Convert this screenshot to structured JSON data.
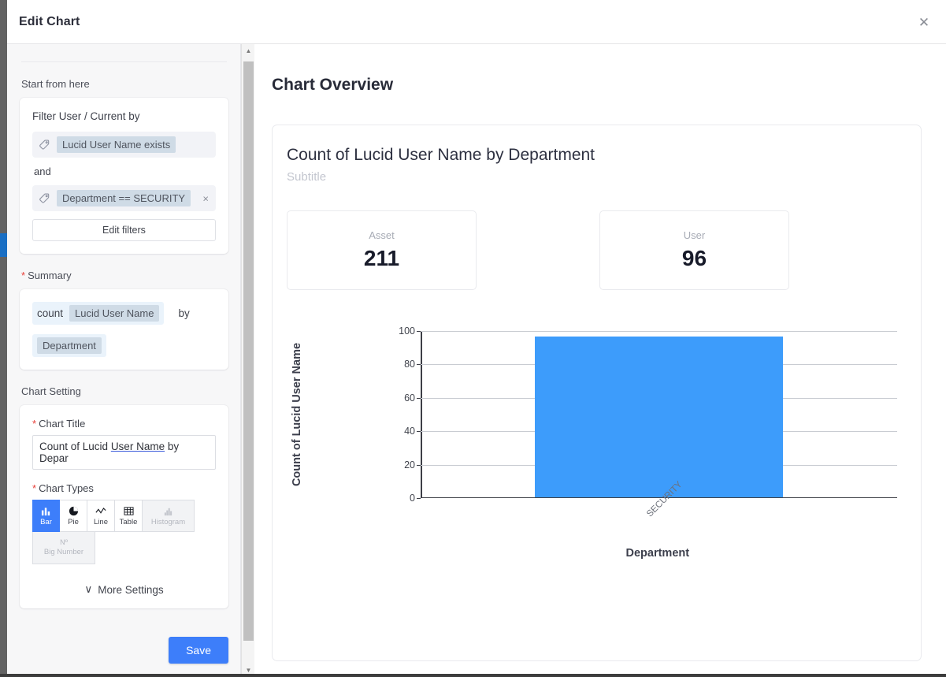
{
  "window": {
    "title": "Edit Chart",
    "close_label": "✕"
  },
  "left_panel": {
    "start_label": "Start from here",
    "filter_card": {
      "title": "Filter User / Current by",
      "conditions": [
        {
          "text": "Lucid User Name exists",
          "removable": false
        },
        {
          "text": "Department == SECURITY",
          "removable": true
        }
      ],
      "conjunction": "and",
      "remove_label": "×",
      "edit_button": "Edit filters"
    },
    "summary": {
      "label": "Summary",
      "required_mark": "*",
      "aggregation": "count",
      "metric": "Lucid User Name",
      "by_word": "by",
      "dimension": "Department"
    },
    "chart_setting": {
      "label": "Chart Setting",
      "chart_title_label": "Chart Title",
      "chart_title_required": "*",
      "chart_title_value_prefix": "Count of Lucid ",
      "chart_title_value_underlined": "User Name",
      "chart_title_value_suffix": " by Depar",
      "chart_types_label": "Chart Types",
      "chart_types_required": "*",
      "types": [
        {
          "id": "bar",
          "label": "Bar",
          "icon": "bar-chart-icon",
          "selected": true,
          "disabled": false
        },
        {
          "id": "pie",
          "label": "Pie",
          "icon": "pie-chart-icon",
          "selected": false,
          "disabled": false
        },
        {
          "id": "line",
          "label": "Line",
          "icon": "line-chart-icon",
          "selected": false,
          "disabled": false
        },
        {
          "id": "table",
          "label": "Table",
          "icon": "table-icon",
          "selected": false,
          "disabled": false
        },
        {
          "id": "histogram",
          "label": "Histogram",
          "icon": "histogram-icon",
          "selected": false,
          "disabled": true
        }
      ],
      "big_number": {
        "label": "Big Number",
        "icon_text": "Nº",
        "disabled": true
      },
      "more_settings": "More Settings",
      "more_settings_chevron": "∨"
    },
    "save_button": "Save"
  },
  "right_panel": {
    "overview_title": "Chart Overview",
    "card": {
      "title": "Count of Lucid User Name by Department",
      "subtitle": "Subtitle",
      "stats": [
        {
          "label": "Asset",
          "value": "211"
        },
        {
          "label": "User",
          "value": "96"
        }
      ]
    }
  },
  "colors": {
    "accent": "#3d7efa",
    "bar": "#3d9cfb",
    "required": "#e8403a",
    "chip": "#cfdbe6"
  },
  "chart_data": {
    "type": "bar",
    "title": "Count of Lucid User Name by Department",
    "subtitle": "Subtitle",
    "categories": [
      "SECURITY"
    ],
    "values": [
      96
    ],
    "xlabel": "Department",
    "ylabel": "Count of Lucid User Name",
    "ylim": [
      0,
      100
    ],
    "yticks": [
      0,
      20,
      40,
      60,
      80,
      100
    ],
    "grid": true,
    "legend": "none",
    "bar_color": "#3d9cfb",
    "xtick_rotation": -45
  }
}
